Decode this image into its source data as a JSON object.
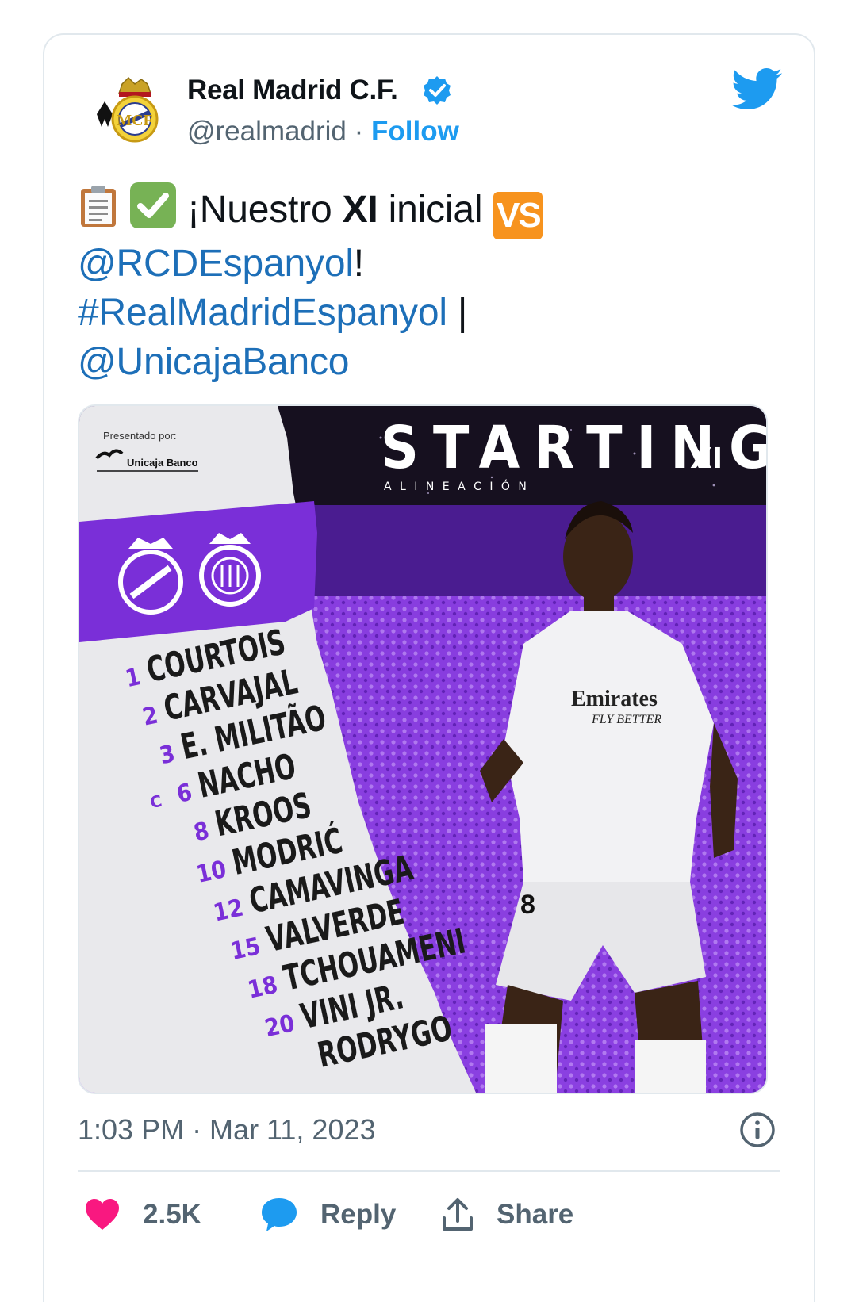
{
  "account": {
    "display_name": "Real Madrid C.F.",
    "handle": "@realmadrid",
    "separator": "·",
    "follow_label": "Follow",
    "verified": true
  },
  "tweet": {
    "intro": "¡Nuestro ",
    "bold": "XI",
    "after_bold": " inicial",
    "vs_label": "VS",
    "mention_1": "@RCDEspanyol",
    "exclaim": "!",
    "hashtag": "#RealMadridEspanyol",
    "pipe": " |",
    "mention_2": "@UnicajaBanco"
  },
  "graphic": {
    "presented_by": "Presentado por:",
    "sponsor": "Unicaja Banco",
    "title": "STARTING",
    "title_suffix": "XI",
    "subtitle": "A L I N E A C I Ó N",
    "captain_marker": "C",
    "lineup": [
      {
        "number": "1",
        "name": "COURTOIS"
      },
      {
        "number": "2",
        "name": "CARVAJAL"
      },
      {
        "number": "3",
        "name": "E. MILITÃO"
      },
      {
        "number": "6",
        "name": "NACHO"
      },
      {
        "number": "8",
        "name": "KROOS"
      },
      {
        "number": "10",
        "name": "MODRIĆ"
      },
      {
        "number": "12",
        "name": "CAMAVINGA"
      },
      {
        "number": "15",
        "name": "VALVERDE"
      },
      {
        "number": "18",
        "name": "TCHOUAMENI"
      },
      {
        "number": "20",
        "name": "VINI JR."
      },
      {
        "number": "",
        "name": "RODRYGO"
      }
    ],
    "jersey_sponsor": "Emirates",
    "jersey_tagline": "FLY BETTER",
    "jersey_number": "8"
  },
  "meta": {
    "timestamp": "1:03 PM · Mar 11, 2023"
  },
  "actions": {
    "like_count": "2.5K",
    "reply_label": "Reply",
    "share_label": "Share"
  },
  "colors": {
    "link": "#1d6fb8",
    "follow": "#1d9bf0",
    "muted": "#536471",
    "purple": "#7a2fd8",
    "heart": "#f91880"
  }
}
